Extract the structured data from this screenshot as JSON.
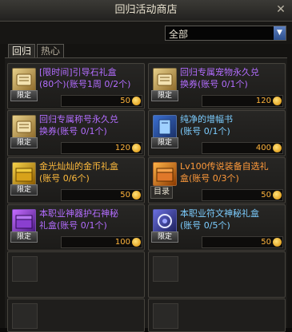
{
  "window": {
    "title": "回归活动商店"
  },
  "filter": {
    "selected": "全部"
  },
  "tabs": [
    {
      "label": "回归"
    },
    {
      "label": "热心"
    }
  ],
  "common": {
    "limit_label": "限定",
    "catalog_label": "目录"
  },
  "items": [
    {
      "name": "[限时间]引导石礼盒\n(80个)(账号1周 0/2个)",
      "price": "50",
      "limited": true,
      "color": "purple"
    },
    {
      "name": "回归专属宠物永久兑\n换券(账号 0/1个)",
      "price": "120",
      "limited": true,
      "color": "purple"
    },
    {
      "name": "回归专属称号永久兑\n换券(账号 0/1个)",
      "price": "120",
      "limited": true,
      "color": "purple"
    },
    {
      "name": "纯净的增幅书\n(账号 0/1个)",
      "price": "400",
      "limited": true,
      "color": "blue"
    },
    {
      "name": "金光灿灿的金币礼盒\n(账号 0/6个)",
      "price": "50",
      "limited": true,
      "color": "gold"
    },
    {
      "name": "Lv100传说装备自选礼\n盒(账号 0/3个)",
      "price": "50",
      "limited": false,
      "color": "orange"
    },
    {
      "name": "本职业神器护石神秘\n礼盒(账号 0/1个)",
      "price": "100",
      "limited": true,
      "color": "purple"
    },
    {
      "name": "本职业符文神秘礼盒\n(账号 0/5个)",
      "price": "50",
      "limited": true,
      "color": "blue"
    }
  ],
  "icons": [
    "scroll-icon",
    "scroll-icon",
    "scroll-icon",
    "book-icon",
    "gold-chest-icon",
    "legend-chest-icon",
    "purple-chest-icon",
    "rune-box-icon"
  ]
}
